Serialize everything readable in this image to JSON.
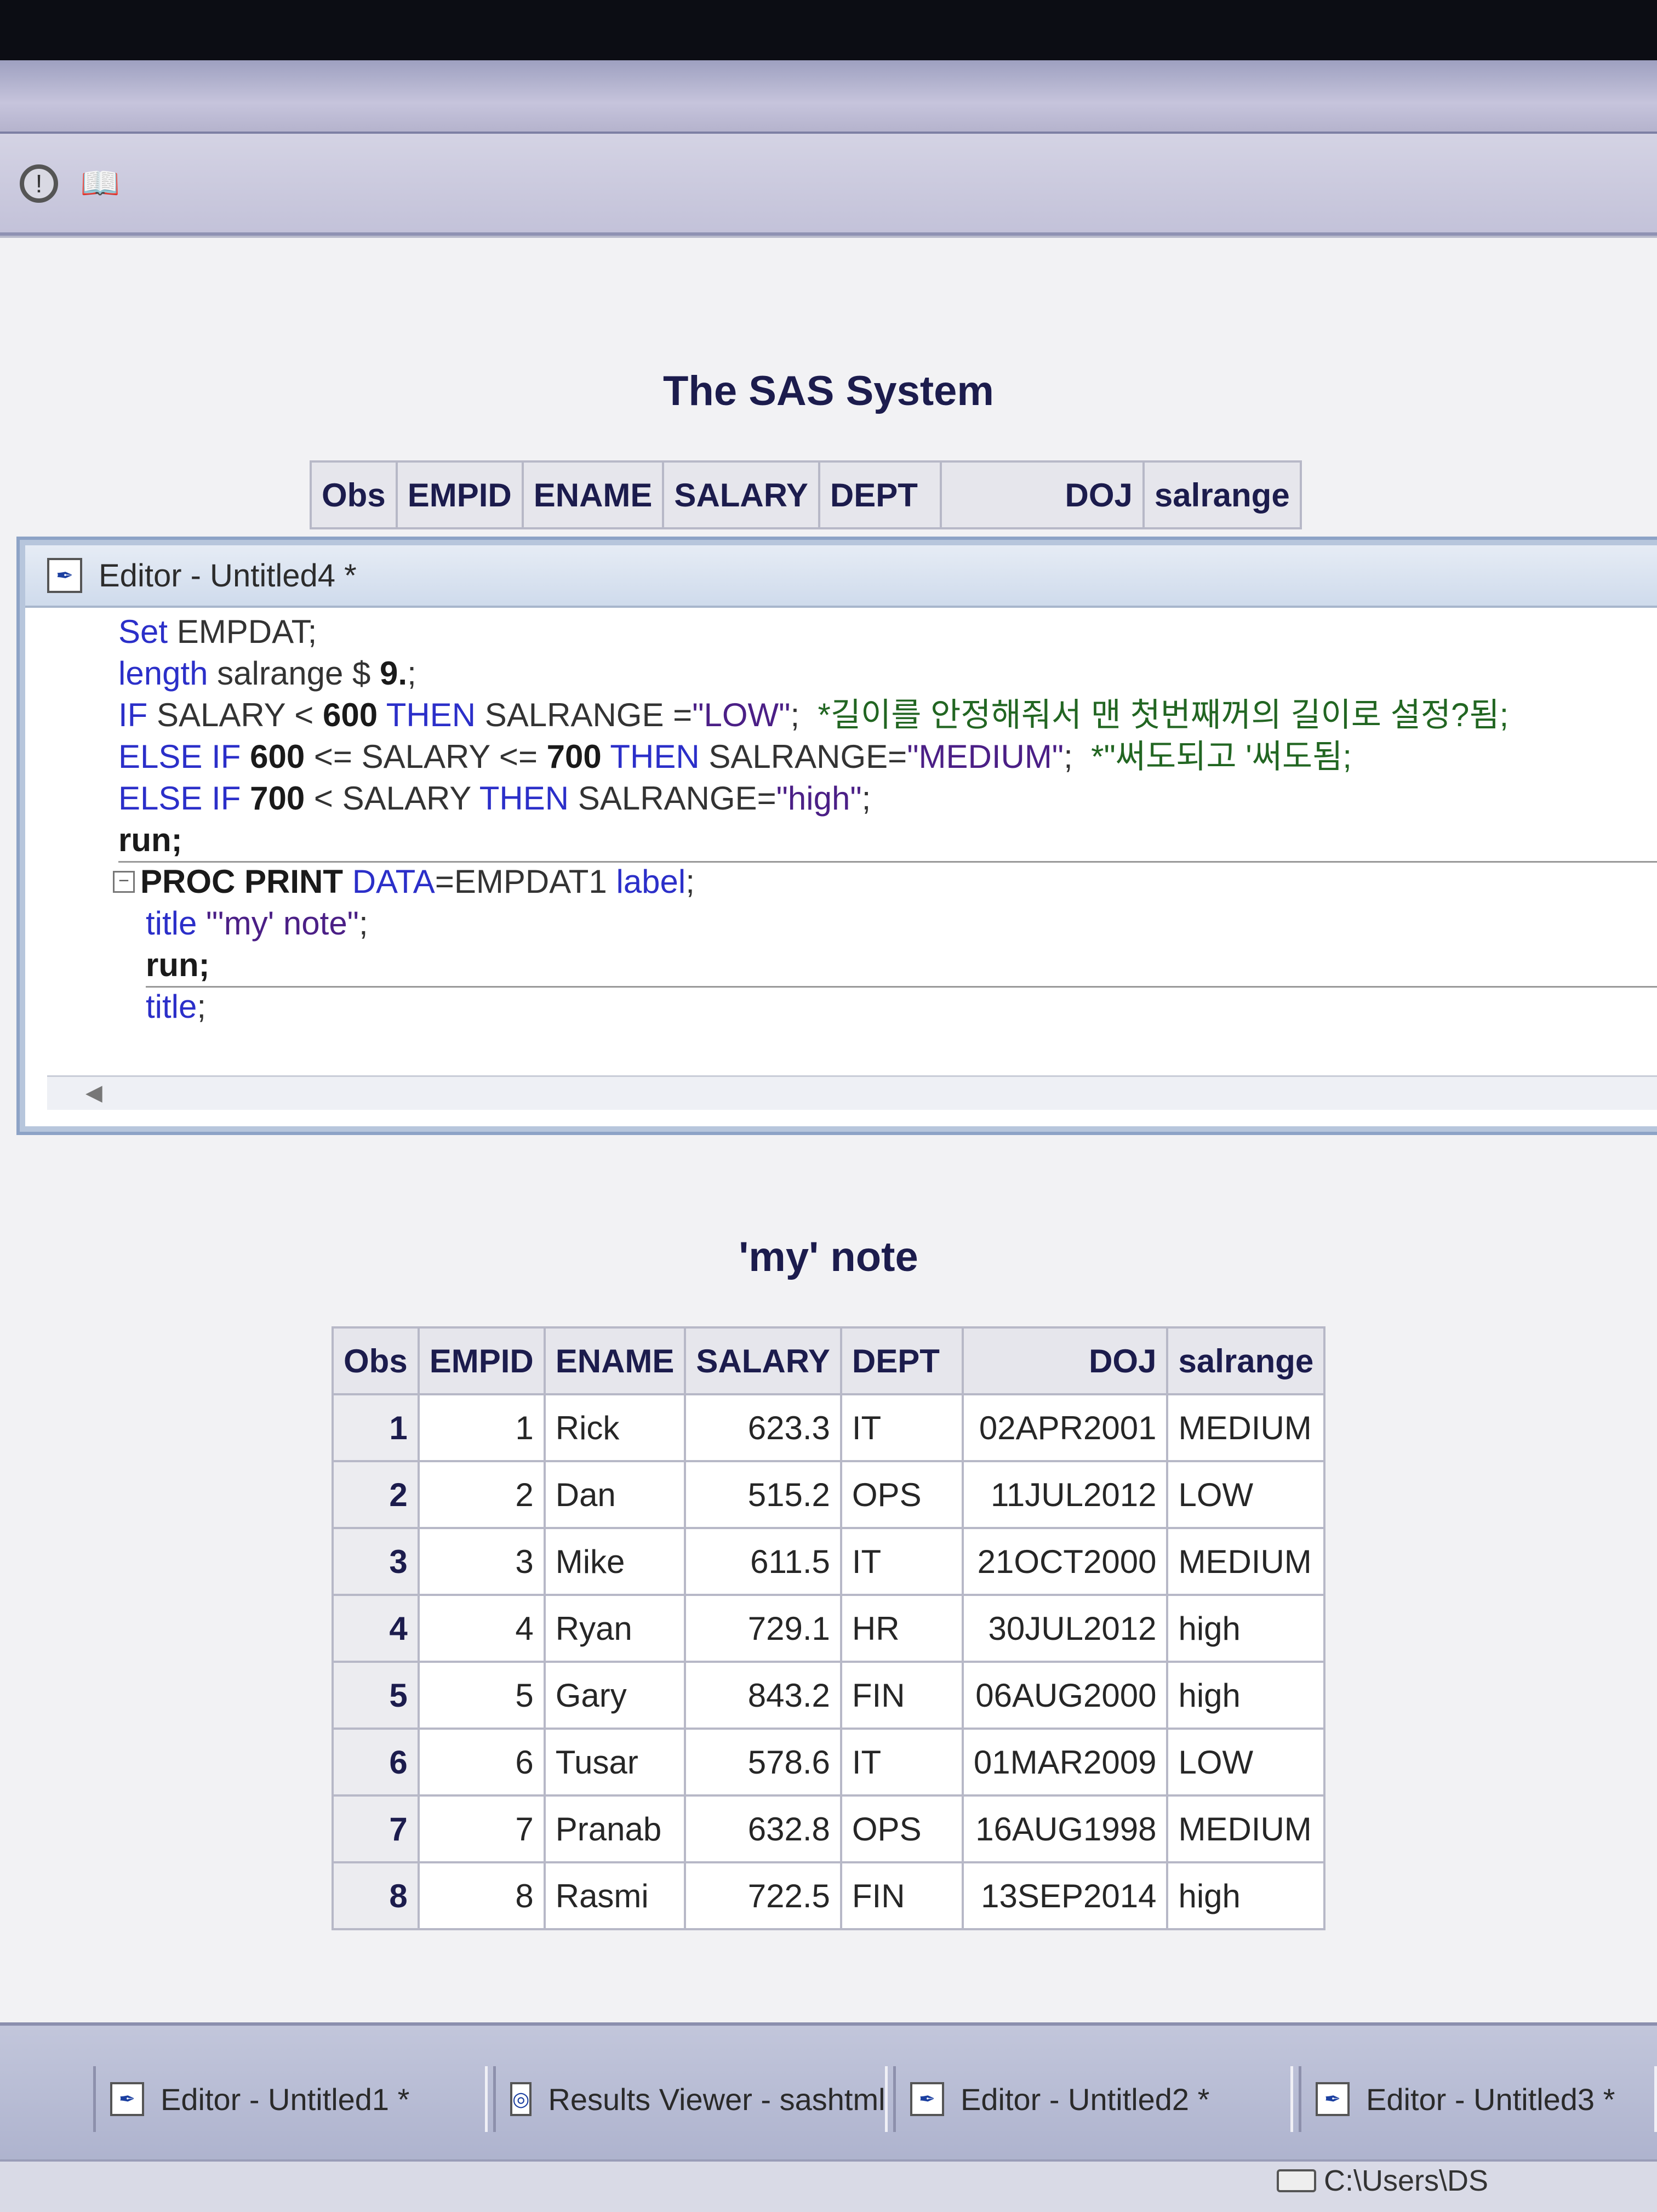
{
  "results": {
    "title1": "The SAS System",
    "title2": "'my' note",
    "columns": [
      "Obs",
      "EMPID",
      "ENAME",
      "SALARY",
      "DEPT",
      "DOJ",
      "salrange"
    ],
    "rows": [
      [
        "1",
        "1",
        "Rick",
        "623.3",
        "IT",
        "02APR2001",
        "MEDIUM"
      ],
      [
        "2",
        "2",
        "Dan",
        "515.2",
        "OPS",
        "11JUL2012",
        "LOW"
      ],
      [
        "3",
        "3",
        "Mike",
        "611.5",
        "IT",
        "21OCT2000",
        "MEDIUM"
      ],
      [
        "4",
        "4",
        "Ryan",
        "729.1",
        "HR",
        "30JUL2012",
        "high"
      ],
      [
        "5",
        "5",
        "Gary",
        "843.2",
        "FIN",
        "06AUG2000",
        "high"
      ],
      [
        "6",
        "6",
        "Tusar",
        "578.6",
        "IT",
        "01MAR2009",
        "LOW"
      ],
      [
        "7",
        "7",
        "Pranab",
        "632.8",
        "OPS",
        "16AUG1998",
        "MEDIUM"
      ],
      [
        "8",
        "8",
        "Rasmi",
        "722.5",
        "FIN",
        "13SEP2014",
        "high"
      ]
    ]
  },
  "editor": {
    "title": "Editor - Untitled4 *",
    "code": {
      "l1_kw": "Set",
      "l1_rest": " EMPDAT;",
      "l2_kw": "length",
      "l2_rest": " salrange $ ",
      "l2_fmt": "9.",
      "l2_end": ";",
      "l3_kw1": "IF",
      "l3_a": " SALARY < ",
      "l3_num": "600",
      "l3_kw2": " THEN",
      "l3_b": " SALRANGE =",
      "l3_str": "\"LOW\"",
      "l3_c": ";  ",
      "l3_cmt": "*길이를 안정해줘서 맨 첫번째꺼의 길이로 설정?됨;",
      "l4_kw1": "ELSE IF",
      "l4_num1": " 600",
      "l4_a": " <= SALARY <= ",
      "l4_num2": "700",
      "l4_kw2": " THEN",
      "l4_b": " SALRANGE=",
      "l4_str": "\"MEDIUM\"",
      "l4_c": ";  ",
      "l4_cmt": "*\"써도되고 '써도됨;",
      "l5_kw1": "ELSE IF",
      "l5_num": " 700",
      "l5_a": " < SALARY ",
      "l5_kw2": "THEN",
      "l5_b": " SALRANGE=",
      "l5_str": "\"high\"",
      "l5_c": ";",
      "l6": "run;",
      "l7_b": "PROC PRINT",
      "l7_kw1": " DATA",
      "l7_a": "=EMPDAT1 ",
      "l7_kw2": "label",
      "l7_c": ";",
      "l8_kw": "title",
      "l8_str": " \"'my' note\"",
      "l8_c": ";",
      "l9": "run;",
      "l10_kw": "title",
      "l10_c": ";"
    }
  },
  "taskbar": {
    "tasks": [
      "Editor - Untitled1 *",
      "Results Viewer - sashtml",
      "Editor - Untitled2 *",
      "Editor - Untitled3 *"
    ]
  },
  "status": {
    "path": "C:\\Users\\DS"
  },
  "icons": {
    "help": "help-circle-icon",
    "book": "book-icon",
    "editor": "editor-window-icon",
    "results": "results-viewer-icon",
    "drive": "drive-icon"
  },
  "colors": {
    "keyword": "#2b2fc9",
    "header_text": "#1c1c4d",
    "window_border": "#8da3c6"
  }
}
